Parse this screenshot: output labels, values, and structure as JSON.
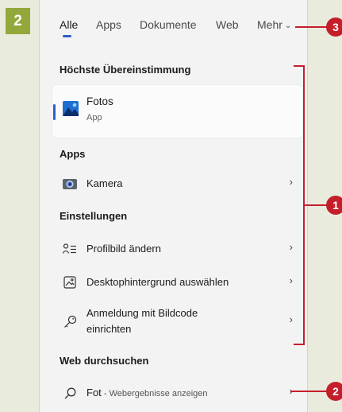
{
  "step_number": "2",
  "tabs": [
    {
      "label": "Alle",
      "active": true
    },
    {
      "label": "Apps"
    },
    {
      "label": "Dokumente"
    },
    {
      "label": "Web"
    },
    {
      "label": "Mehr"
    }
  ],
  "sections": {
    "best_match": "Höchste Übereinstimmung",
    "apps": "Apps",
    "settings": "Einstellungen",
    "web": "Web durchsuchen"
  },
  "best_match_item": {
    "title": "Fotos",
    "subtitle": "App",
    "icon": "photos-icon"
  },
  "apps_items": [
    {
      "label": "Kamera",
      "icon": "camera-icon"
    }
  ],
  "settings_items": [
    {
      "label": "Profilbild ändern",
      "icon": "person-list-icon"
    },
    {
      "label": "Desktophintergrund auswählen",
      "icon": "picture-frame-icon"
    },
    {
      "label_line1": "Anmeldung mit Bildcode",
      "label_line2": "einrichten",
      "icon": "key-icon"
    }
  ],
  "web_item": {
    "query": "Fot",
    "sep": " - ",
    "hint": "Webergebnisse anzeigen",
    "icon": "search-icon"
  },
  "callouts": [
    "1",
    "2",
    "3"
  ],
  "colors": {
    "accent": "#2f5fc6",
    "callout": "#c51e2b",
    "badge": "#93a83a"
  }
}
